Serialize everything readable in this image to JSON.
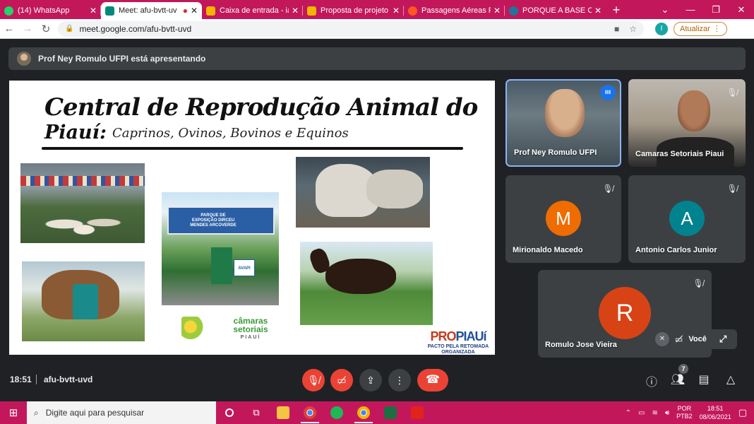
{
  "browser": {
    "tabs": [
      {
        "title": "(14) WhatsApp",
        "favicon_color": "#25d366",
        "active": false
      },
      {
        "title": "Meet: afu-bvtt-uv",
        "favicon_color": "#00897b",
        "active": true
      },
      {
        "title": "Caixa de entrada - iasr",
        "favicon_color": "#f4b400",
        "active": false
      },
      {
        "title": "Proposta de projeto d",
        "favicon_color": "#f4b400",
        "active": false
      },
      {
        "title": "Passagens Aéreas Pro",
        "favicon_color": "#ff5722",
        "active": false
      },
      {
        "title": "PORQUE A BASE CRA",
        "favicon_color": "#21759b",
        "active": false
      }
    ],
    "new_tab": "+",
    "url": "meet.google.com/afu-bvtt-uvd",
    "profile_initial": "I",
    "update_label": "Atualizar"
  },
  "presenter_bar": {
    "text": "Prof Ney Romulo UFPI está apresentando"
  },
  "slide": {
    "title_line1": "Central de Reprodução Animal do",
    "title_line2_bold": "Piauí:",
    "title_line2_rest": "Caprinos, Ovinos, Bovinos e Equinos",
    "sign_text": "PARQUE DE EXPOSIÇÃO DIRCEU MENDES ARCOVERDE",
    "avapi_label": "AVAPI",
    "camaras_logo": "câmaras setoriais",
    "camaras_sub": "PIAUÍ",
    "propiaui_logo_a": "PRO",
    "propiaui_logo_b": "PIAUí",
    "propiaui_sub": "PACTO PELA RETOMADA ORGANIZADA"
  },
  "participants": [
    {
      "name": "Prof Ney Romulo UFPI",
      "type": "video",
      "speaking": true
    },
    {
      "name": "Camaras Setoriais Piaui",
      "type": "video",
      "muted": true
    },
    {
      "name": "Mirionaldo Macedo",
      "initial": "M",
      "color": "#ef6c00",
      "muted": true
    },
    {
      "name": "Antonio Carlos Junior",
      "initial": "A",
      "color": "#00838f",
      "muted": true
    },
    {
      "name": "Romulo Jose Vieira",
      "initial": "R",
      "color": "#d84315",
      "muted": true
    }
  ],
  "self_view": {
    "label": "Você"
  },
  "meeting": {
    "time": "18:51",
    "code": "afu-bvtt-uvd",
    "participant_count": "7"
  },
  "taskbar": {
    "search_placeholder": "Digite aqui para pesquisar",
    "lang_top": "POR",
    "lang_bottom": "PTB2",
    "time": "18:51",
    "date": "08/06/2021"
  }
}
